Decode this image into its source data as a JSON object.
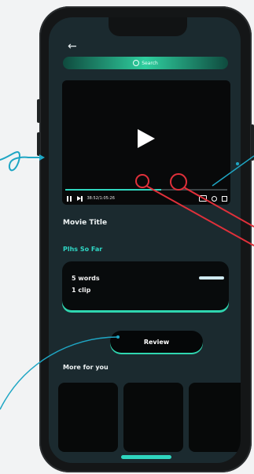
{
  "colors": {
    "accent": "#2fd6bf",
    "annotation_blue": "#1fa6c4",
    "annotation_red": "#e0303a",
    "screen_bg": "#1b2a2f"
  },
  "header": {
    "back_icon": "arrow-left-icon",
    "search_placeholder": "Search"
  },
  "player": {
    "current_time": "38:52",
    "total_time": "1:05:26",
    "time_display": "38:52/1:05:26",
    "progress_fraction": 0.59,
    "icons": [
      "pause-icon",
      "next-icon",
      "captions-icon",
      "gear-icon",
      "fullscreen-icon"
    ]
  },
  "content": {
    "movie_title": "Movie Title",
    "section_label": "Plhs So Far",
    "summary": {
      "words": "5 words",
      "clips": "1 clip"
    },
    "review_label": "Review",
    "more_label": "More for you"
  }
}
